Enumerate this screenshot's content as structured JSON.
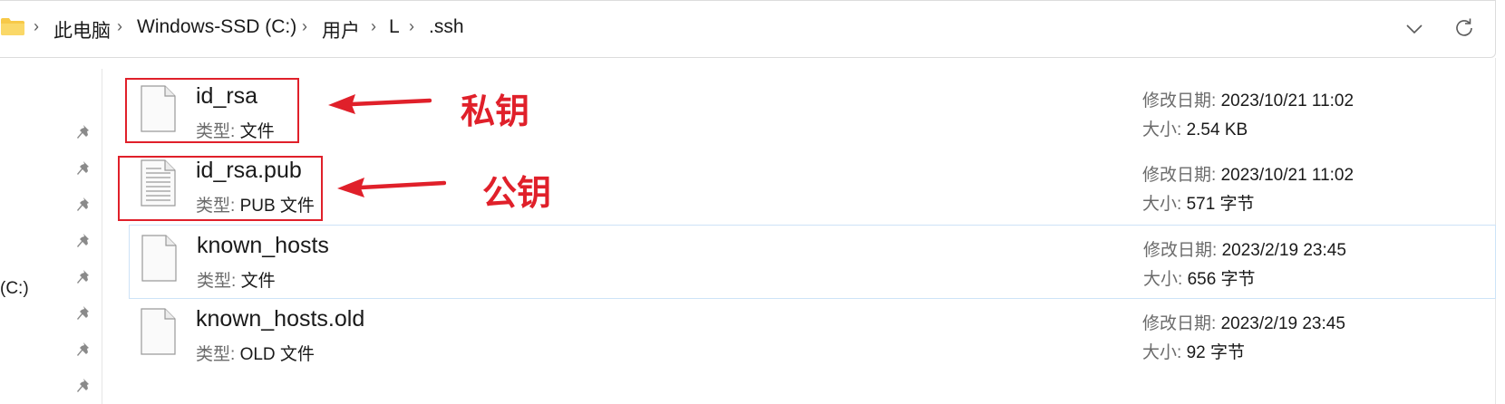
{
  "address_bar": {
    "breadcrumbs": [
      "此电脑",
      "Windows-SSD (C:)",
      "用户",
      "L",
      ".ssh"
    ],
    "separator": "›",
    "dropdown_icon": "chevron-down-icon",
    "refresh_icon": "refresh-icon"
  },
  "sidebar": {
    "pin_icon": "pin-icon",
    "pin_count": 8,
    "drive_label": "(C:)"
  },
  "meta_labels": {
    "modified": "修改日期: ",
    "size": "大小: ",
    "type": "类型: "
  },
  "files": [
    {
      "name": "id_rsa",
      "type": "文件",
      "modified": "2023/10/21 11:02",
      "size": "2.54 KB",
      "icon": "blank-file-icon"
    },
    {
      "name": "id_rsa.pub",
      "type": "PUB 文件",
      "modified": "2023/10/21 11:02",
      "size": "571 字节",
      "icon": "text-file-icon"
    },
    {
      "name": "known_hosts",
      "type": "文件",
      "modified": "2023/2/19 23:45",
      "size": "656 字节",
      "icon": "blank-file-icon"
    },
    {
      "name": "known_hosts.old",
      "type": "OLD 文件",
      "modified": "2023/2/19 23:45",
      "size": "92 字节",
      "icon": "blank-file-icon"
    }
  ],
  "annotations": {
    "private_key": "私钥",
    "public_key": "公钥",
    "color": "#e0202a"
  },
  "colors": {
    "accent_border": "#cde3f7",
    "folder": "#f7c948"
  }
}
